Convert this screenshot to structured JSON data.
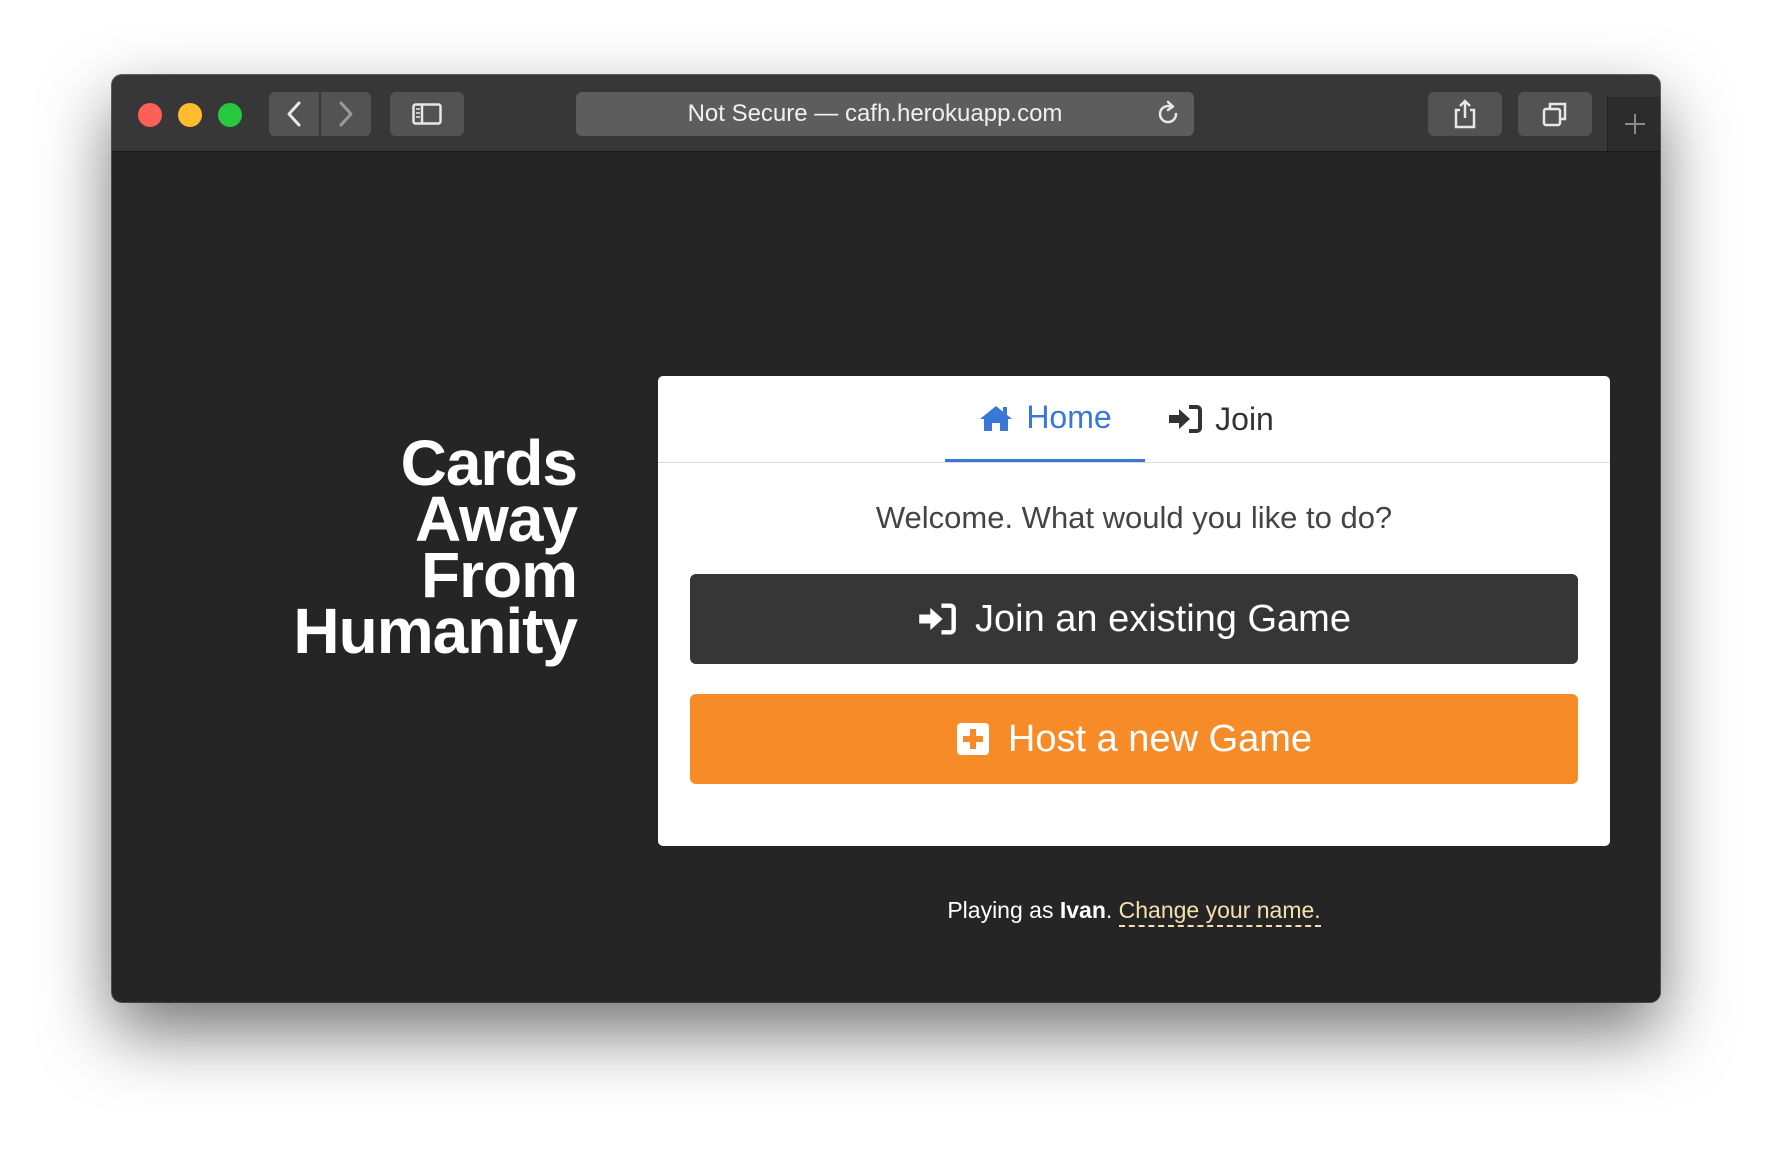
{
  "browser": {
    "address": "Not Secure — cafh.herokuapp.com",
    "icons": [
      "back-icon",
      "forward-icon",
      "sidebar-icon",
      "reload-icon",
      "share-icon",
      "tabs-icon",
      "new-tab-icon"
    ]
  },
  "brand": {
    "lines": [
      "Cards",
      "Away",
      "From",
      "Humanity"
    ]
  },
  "tabs": [
    {
      "label": "Home",
      "icon": "home-icon",
      "active": true
    },
    {
      "label": "Join",
      "icon": "sign-in-icon",
      "active": false
    }
  ],
  "welcome": "Welcome. What would you like to do?",
  "buttons": {
    "join": {
      "label": "Join an existing Game",
      "icon": "sign-in-icon"
    },
    "host": {
      "label": "Host a new Game",
      "icon": "plus-square-icon"
    }
  },
  "footer": {
    "prefix": "Playing as ",
    "name": "Ivan",
    "period": ". ",
    "link": "Change your name."
  },
  "colors": {
    "accent": "#3a78d8",
    "host_button": "#f68b27",
    "join_button": "#363636",
    "page_bg": "#252525",
    "link": "#f5e1b0"
  }
}
